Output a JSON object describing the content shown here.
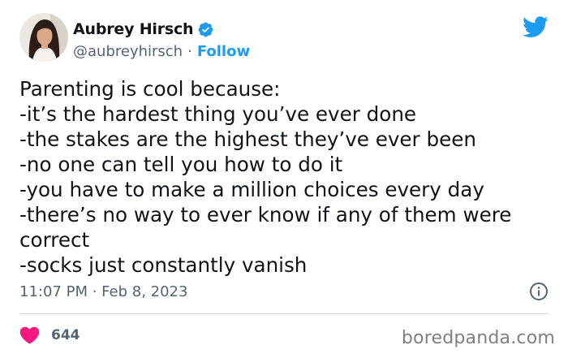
{
  "author": {
    "name": "Aubrey Hirsch",
    "handle": "@aubreyhirsch",
    "separator": "·",
    "follow_label": "Follow",
    "verified_icon": "verified-badge-icon",
    "verified_color": "#1d9bf0"
  },
  "brand": {
    "icon": "twitter-bird-icon",
    "color": "#1d9bf0"
  },
  "tweet": {
    "lines": [
      "Parenting is cool because:",
      "-it’s the hardest thing you’ve ever done",
      "-the stakes are the highest they’ve ever been",
      "-no one can tell you how to do it",
      "-you have to make a million choices every day",
      "-there’s no way to ever know if any of them were",
      "correct",
      "-socks just constantly vanish"
    ],
    "timestamp": "11:07 PM · Feb 8, 2023",
    "info_icon": "info-icon"
  },
  "engagement": {
    "like_icon": "heart-icon",
    "like_color": "#f91880",
    "like_count": "644"
  },
  "watermark": {
    "text": "boredpanda.com"
  }
}
